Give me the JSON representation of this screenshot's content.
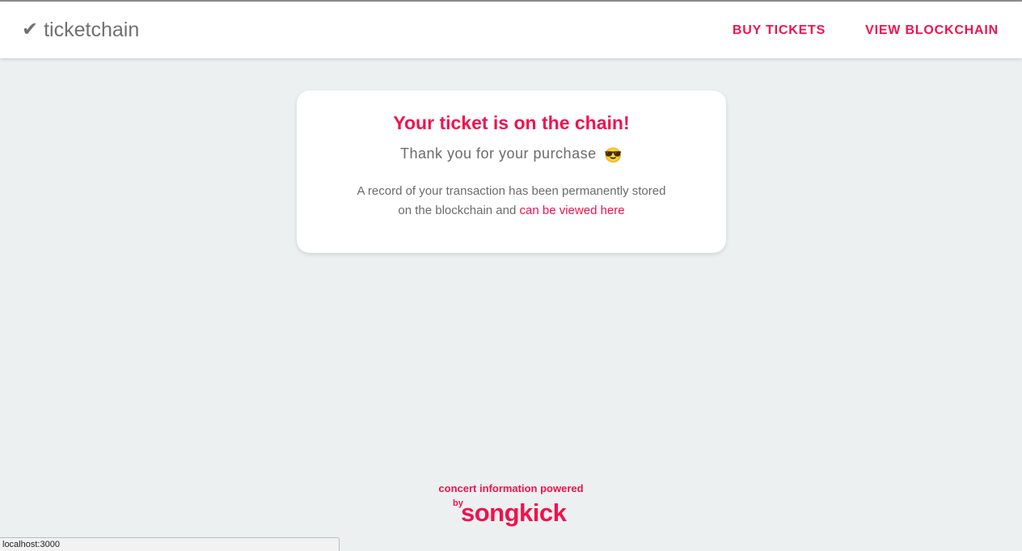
{
  "header": {
    "logo_icon": "✔",
    "logo_text": "ticketchain",
    "nav": [
      {
        "label": "BUY TICKETS"
      },
      {
        "label": "VIEW BLOCKCHAIN"
      }
    ]
  },
  "confirmation": {
    "title": "Your ticket is on the chain!",
    "subtitle": "Thank you for your purchase",
    "subtitle_emoji": "😎",
    "body_text": "A record of your transaction has been permanently stored on the blockchain and",
    "body_link": "can be viewed here"
  },
  "footer": {
    "powered_text": "concert information powered",
    "songkick_by": "by",
    "songkick_word": "songkick"
  },
  "status_bar": {
    "url": "localhost:3000"
  },
  "colors": {
    "accent": "#f0124d",
    "background": "#edf0f1",
    "text_muted": "#6b6b6b"
  }
}
